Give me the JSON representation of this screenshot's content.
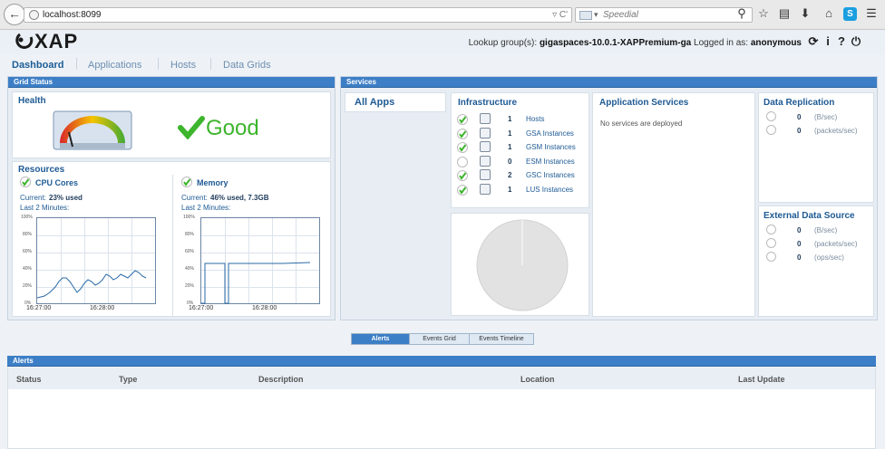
{
  "browser": {
    "back_icon": "back-arrow-icon",
    "url": "localhost:8099",
    "url_controls": "▿ C'",
    "search_placeholder": "Speedial",
    "toolbar_icons": [
      "search-icon",
      "bookmark-star-icon",
      "library-icon",
      "download-icon",
      "home-icon",
      "skype-icon",
      "menu-icon"
    ]
  },
  "app": {
    "logo": "XAP",
    "lookup_label": "Lookup group(s):",
    "lookup_value": "gigaspaces-10.0.1-XAPPremium-ga",
    "logged_label": "Logged in as:",
    "logged_value": "anonymous",
    "header_icons": [
      "refresh-icon",
      "info-icon",
      "help-icon",
      "power-icon"
    ]
  },
  "nav": {
    "items": [
      {
        "label": "Dashboard",
        "active": true
      },
      {
        "label": "Applications"
      },
      {
        "label": "Hosts"
      },
      {
        "label": "Data Grids"
      }
    ]
  },
  "grid_status": {
    "bar_title": "Grid Status",
    "health_title": "Health",
    "health_status": "Good",
    "resources_title": "Resources",
    "cpu": {
      "title": "CPU Cores",
      "current_label": "Current:",
      "current_value": "23% used",
      "last_label": "Last 2 Minutes:",
      "y_ticks": [
        "100%",
        "80%",
        "60%",
        "40%",
        "20%",
        "0%"
      ],
      "x_ticks": [
        "16:27:00",
        "16:28:00"
      ]
    },
    "memory": {
      "title": "Memory",
      "current_label": "Current:",
      "current_value": "46% used, 7.3GB",
      "last_label": "Last 2 Minutes:",
      "y_ticks": [
        "100%",
        "80%",
        "60%",
        "40%",
        "20%",
        "0%"
      ],
      "x_ticks": [
        "16:27:00",
        "16:28:00"
      ]
    }
  },
  "services": {
    "bar_title": "Services",
    "all_apps": "All Apps",
    "infrastructure": {
      "title": "Infrastructure",
      "rows": [
        {
          "count": "1",
          "label": "Hosts",
          "ok": true,
          "icon": "host-icon"
        },
        {
          "count": "1",
          "label": "GSA Instances",
          "ok": true,
          "icon": "gsa-icon"
        },
        {
          "count": "1",
          "label": "GSM Instances",
          "ok": true,
          "icon": "gsm-icon"
        },
        {
          "count": "0",
          "label": "ESM Instances",
          "ok": false,
          "icon": "esm-icon"
        },
        {
          "count": "2",
          "label": "GSC Instances",
          "ok": true,
          "icon": "gsc-icon"
        },
        {
          "count": "1",
          "label": "LUS Instances",
          "ok": true,
          "icon": "lus-icon"
        }
      ]
    },
    "app_services": {
      "title": "Application Services",
      "empty": "No services are deployed"
    },
    "data_replication": {
      "title": "Data Replication",
      "rows": [
        {
          "value": "0",
          "unit": "(B/sec)"
        },
        {
          "value": "0",
          "unit": "(packets/sec)"
        }
      ]
    },
    "external_data_source": {
      "title": "External Data Source",
      "rows": [
        {
          "value": "0",
          "unit": "(B/sec)"
        },
        {
          "value": "0",
          "unit": "(packets/sec)"
        },
        {
          "value": "0",
          "unit": "(ops/sec)"
        }
      ]
    }
  },
  "bottom_tabs": [
    {
      "label": "Alerts",
      "active": true
    },
    {
      "label": "Events Grid"
    },
    {
      "label": "Events Timeline"
    }
  ],
  "alerts": {
    "bar_title": "Alerts",
    "columns": [
      "Status",
      "Type",
      "Description",
      "Location",
      "Last Update"
    ]
  },
  "colors": {
    "accent": "#3d7fc6",
    "ok_green": "#3db52d",
    "title_blue": "#1e5a94"
  }
}
